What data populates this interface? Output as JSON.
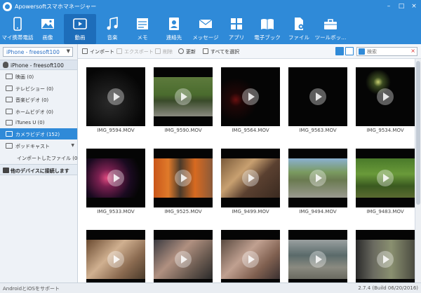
{
  "app": {
    "title": "Apowersoftスマホマネージャー",
    "window_controls": [
      "–",
      "□",
      "×"
    ]
  },
  "nav": [
    {
      "label": "マイ携帯電話",
      "icon": "phone-icon"
    },
    {
      "label": "画像",
      "icon": "image-icon"
    },
    {
      "label": "動画",
      "icon": "video-icon",
      "active": true
    },
    {
      "label": "音楽",
      "icon": "music-icon"
    },
    {
      "label": "メモ",
      "icon": "memo-icon"
    },
    {
      "label": "連絡先",
      "icon": "contacts-icon"
    },
    {
      "label": "メッセージ",
      "icon": "message-icon"
    },
    {
      "label": "アプリ",
      "icon": "apps-icon"
    },
    {
      "label": "電子ブック",
      "icon": "book-icon"
    },
    {
      "label": "ファイル",
      "icon": "file-icon"
    },
    {
      "label": "ツールボッ...",
      "icon": "toolbox-icon"
    }
  ],
  "sidebar": {
    "device_select": "iPhone - freesoft100",
    "device_header": "iPhone - freesoft100",
    "items": [
      {
        "label": "映画 (0)"
      },
      {
        "label": "テレビショー (0)"
      },
      {
        "label": "音楽ビデオ (0)"
      },
      {
        "label": "ホームビデオ (0)"
      },
      {
        "label": "iTunes U (0)"
      },
      {
        "label": "カメラビデオ (152)",
        "active": true
      },
      {
        "label": "ポッドキャスト"
      },
      {
        "label": "インポートしたファイル (0)"
      }
    ],
    "connect_other": "他のデバイスに接続します"
  },
  "actions": {
    "import": "インポート",
    "export": "エクスポート",
    "delete": "削除",
    "refresh": "更新",
    "select_all": "すべてを選択"
  },
  "search": {
    "placeholder": "検索"
  },
  "videos": [
    {
      "name": "IMG_9594.MOV"
    },
    {
      "name": "IMG_9590.MOV"
    },
    {
      "name": "IMG_9564.MOV"
    },
    {
      "name": "IMG_9563.MOV"
    },
    {
      "name": "IMG_9534.MOV"
    },
    {
      "name": "IMG_9533.MOV"
    },
    {
      "name": "IMG_9525.MOV"
    },
    {
      "name": "IMG_9499.MOV"
    },
    {
      "name": "IMG_9494.MOV"
    },
    {
      "name": "IMG_9483.MOV"
    },
    {
      "name": ""
    },
    {
      "name": ""
    },
    {
      "name": ""
    },
    {
      "name": ""
    },
    {
      "name": ""
    }
  ],
  "status": {
    "left": "AndroidとiOSをサポート",
    "right": "2.7.4 (Build 06/20/2016)"
  },
  "colors": {
    "accent": "#2f8ad8",
    "active_nav": "#1d6dba"
  }
}
